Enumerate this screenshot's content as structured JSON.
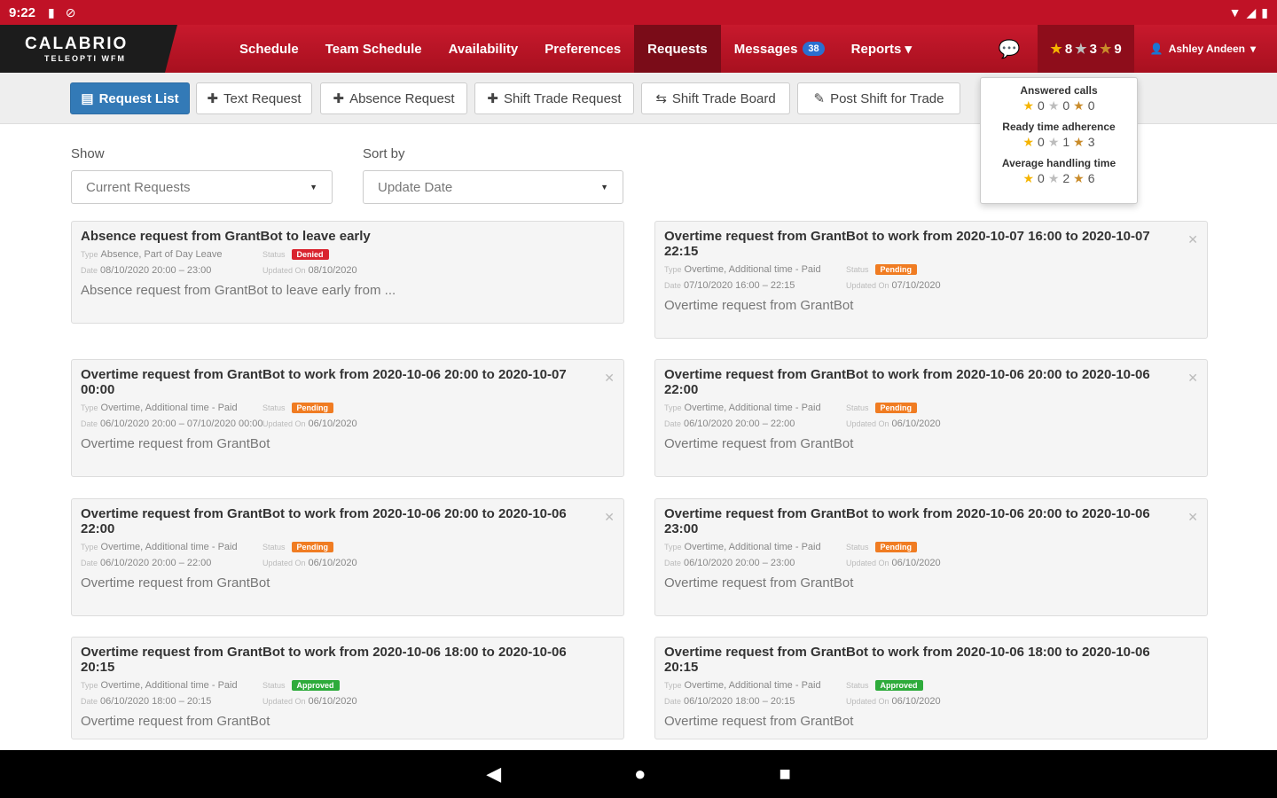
{
  "statusbar": {
    "time": "9:22",
    "icons_left": [
      "sd-card-icon",
      "dnd-icon"
    ],
    "icons_right": [
      "wifi-icon",
      "signal-icon",
      "battery-icon"
    ]
  },
  "brand": {
    "name": "CALABRIO",
    "sub": "TELEOPTI WFM"
  },
  "nav": {
    "items": [
      {
        "label": "Schedule",
        "active": false
      },
      {
        "label": "Team Schedule",
        "active": false
      },
      {
        "label": "Availability",
        "active": false
      },
      {
        "label": "Preferences",
        "active": false
      },
      {
        "label": "Requests",
        "active": true
      },
      {
        "label": "Messages",
        "active": false
      },
      {
        "label": "Reports ▾",
        "active": false
      }
    ],
    "messages_badge": "38",
    "stars": {
      "gold": "8",
      "silver": "3",
      "bronze": "9"
    },
    "user": "Ashley Andeen"
  },
  "toolbar": {
    "request_list": "Request List",
    "text_request": "Text Request",
    "absence_request": "Absence Request",
    "shift_trade_request": "Shift Trade Request",
    "shift_trade_board": "Shift Trade Board",
    "post_shift": "Post Shift for Trade"
  },
  "filters": {
    "show_label": "Show",
    "show_value": "Current Requests",
    "sort_label": "Sort by",
    "sort_value": "Update Date"
  },
  "popover": {
    "metrics": [
      {
        "name": "Answered calls",
        "gold": "0",
        "silver": "0",
        "bronze": "0"
      },
      {
        "name": "Ready time adherence",
        "gold": "0",
        "silver": "1",
        "bronze": "3"
      },
      {
        "name": "Average handling time",
        "gold": "0",
        "silver": "2",
        "bronze": "6"
      }
    ]
  },
  "labels": {
    "type": "Type",
    "status": "Status",
    "date": "Date",
    "updated_on": "Updated On"
  },
  "requests": [
    {
      "title": "Absence request from GrantBot to leave early",
      "type": "Absence, Part of Day Leave",
      "status": "Denied",
      "status_class": "denied",
      "date": "08/10/2020 20:00 – 23:00",
      "updated": "08/10/2020",
      "body": "Absence request from GrantBot to leave early from ...",
      "closable": false
    },
    {
      "title": "Overtime request from GrantBot to work from 2020-10-07 16:00 to 2020-10-07 22:15",
      "type": "Overtime, Additional time - Paid",
      "status": "Pending",
      "status_class": "pending",
      "date": "07/10/2020 16:00 – 22:15",
      "updated": "07/10/2020",
      "body": "Overtime request from GrantBot",
      "closable": true
    },
    {
      "title": "Overtime request from GrantBot to work from 2020-10-06 20:00 to 2020-10-07 00:00",
      "type": "Overtime, Additional time - Paid",
      "status": "Pending",
      "status_class": "pending",
      "date": "06/10/2020 20:00 – 07/10/2020 00:00",
      "updated": "06/10/2020",
      "body": "Overtime request from GrantBot",
      "closable": true
    },
    {
      "title": "Overtime request from GrantBot to work from 2020-10-06 20:00 to 2020-10-06 22:00",
      "type": "Overtime, Additional time - Paid",
      "status": "Pending",
      "status_class": "pending",
      "date": "06/10/2020 20:00 – 22:00",
      "updated": "06/10/2020",
      "body": "Overtime request from GrantBot",
      "closable": true
    },
    {
      "title": "Overtime request from GrantBot to work from 2020-10-06 20:00 to 2020-10-06 22:00",
      "type": "Overtime, Additional time - Paid",
      "status": "Pending",
      "status_class": "pending",
      "date": "06/10/2020 20:00 – 22:00",
      "updated": "06/10/2020",
      "body": "Overtime request from GrantBot",
      "closable": true
    },
    {
      "title": "Overtime request from GrantBot to work from 2020-10-06 20:00 to 2020-10-06 23:00",
      "type": "Overtime, Additional time - Paid",
      "status": "Pending",
      "status_class": "pending",
      "date": "06/10/2020 20:00 – 23:00",
      "updated": "06/10/2020",
      "body": "Overtime request from GrantBot",
      "closable": true
    },
    {
      "title": "Overtime request from GrantBot to work from 2020-10-06 18:00 to 2020-10-06 20:15",
      "type": "Overtime, Additional time - Paid",
      "status": "Approved",
      "status_class": "approved",
      "date": "06/10/2020 18:00 – 20:15",
      "updated": "06/10/2020",
      "body": "Overtime request from GrantBot",
      "closable": false
    },
    {
      "title": "Overtime request from GrantBot to work from 2020-10-06 18:00 to 2020-10-06 20:15",
      "type": "Overtime, Additional time - Paid",
      "status": "Approved",
      "status_class": "approved",
      "date": "06/10/2020 18:00 – 20:15",
      "updated": "06/10/2020",
      "body": "Overtime request from GrantBot",
      "closable": false
    }
  ]
}
